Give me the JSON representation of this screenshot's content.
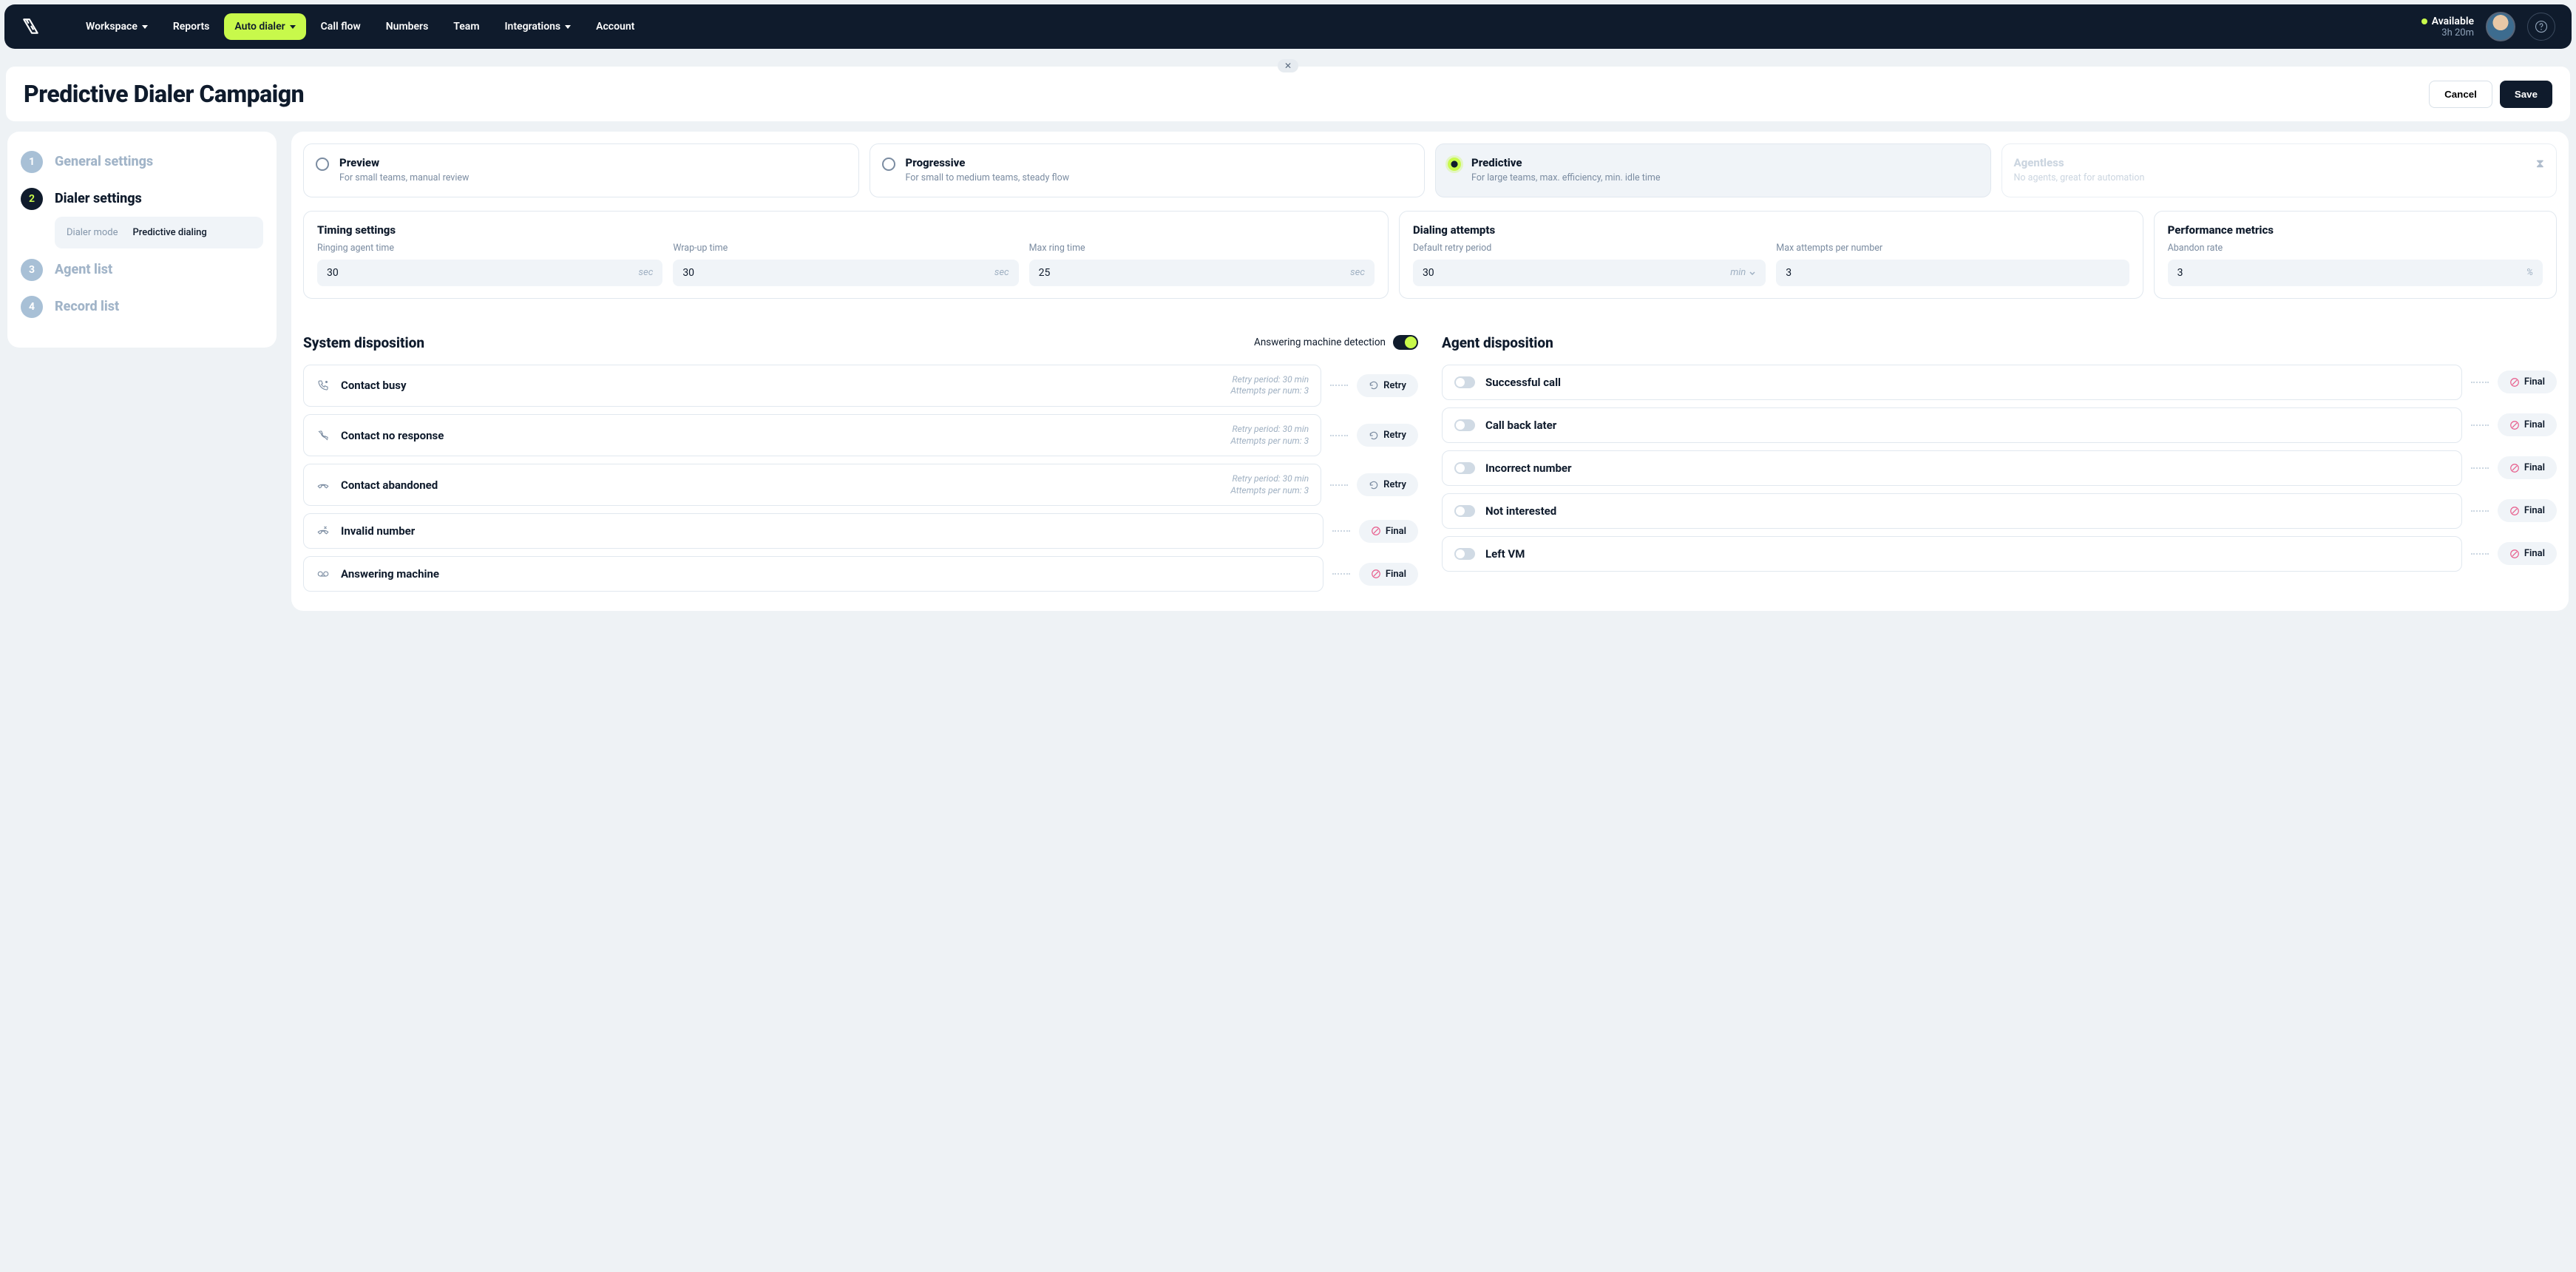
{
  "nav": {
    "items": [
      {
        "label": "Workspace",
        "hasDropdown": true
      },
      {
        "label": "Reports"
      },
      {
        "label": "Auto dialer",
        "hasDropdown": true,
        "active": true
      },
      {
        "label": "Call flow"
      },
      {
        "label": "Numbers"
      },
      {
        "label": "Team"
      },
      {
        "label": "Integrations",
        "hasDropdown": true
      },
      {
        "label": "Account"
      }
    ],
    "status": {
      "label": "Available",
      "duration": "3h 20m"
    }
  },
  "header": {
    "title": "Predictive Dialer Campaign",
    "cancel": "Cancel",
    "save": "Save"
  },
  "steps": [
    {
      "num": "1",
      "title": "General settings"
    },
    {
      "num": "2",
      "title": "Dialer settings",
      "active": true,
      "sub": {
        "label": "Dialer mode",
        "value": "Predictive dialing"
      }
    },
    {
      "num": "3",
      "title": "Agent list"
    },
    {
      "num": "4",
      "title": "Record list"
    }
  ],
  "modes": [
    {
      "name": "Preview",
      "desc": "For small teams, manual review"
    },
    {
      "name": "Progressive",
      "desc": "For small to medium teams, steady flow"
    },
    {
      "name": "Predictive",
      "desc": "For large teams, max. efficiency, min. idle time",
      "selected": true
    },
    {
      "name": "Agentless",
      "desc": "No agents, great for automation",
      "disabled": true
    }
  ],
  "timing": {
    "title": "Timing settings",
    "fields": [
      {
        "label": "Ringing agent time",
        "value": "30",
        "unit": "sec"
      },
      {
        "label": "Wrap-up time",
        "value": "30",
        "unit": "sec"
      },
      {
        "label": "Max ring time",
        "value": "25",
        "unit": "sec"
      }
    ]
  },
  "attempts": {
    "title": "Dialing attempts",
    "fields": [
      {
        "label": "Default retry period",
        "value": "30",
        "unit": "min",
        "dropdown": true
      },
      {
        "label": "Max attempts per number",
        "value": "3"
      }
    ]
  },
  "metrics": {
    "title": "Performance metrics",
    "fields": [
      {
        "label": "Abandon rate",
        "value": "3",
        "unit": "%"
      }
    ]
  },
  "system_dispo": {
    "title": "System disposition",
    "amd_label": "Answering machine detection",
    "retry_label": "Retry",
    "final_label": "Final",
    "retry_prefix": "Retry period: ",
    "attempts_prefix": "Attempts per num: ",
    "items": [
      {
        "name": "Contact busy",
        "icon": "phone-busy",
        "retry": "30 min",
        "attempts": "3",
        "action": "retry"
      },
      {
        "name": "Contact no response",
        "icon": "phone-slash",
        "retry": "30 min",
        "attempts": "3",
        "action": "retry"
      },
      {
        "name": "Contact abandoned",
        "icon": "phone-down",
        "retry": "30 min",
        "attempts": "3",
        "action": "retry"
      },
      {
        "name": "Invalid number",
        "icon": "phone-x",
        "action": "final"
      },
      {
        "name": "Answering machine",
        "icon": "voicemail",
        "action": "final"
      }
    ]
  },
  "agent_dispo": {
    "title": "Agent disposition",
    "final_label": "Final",
    "items": [
      {
        "name": "Successful call"
      },
      {
        "name": "Call back later"
      },
      {
        "name": "Incorrect number"
      },
      {
        "name": "Not interested"
      },
      {
        "name": "Left VM"
      }
    ]
  }
}
